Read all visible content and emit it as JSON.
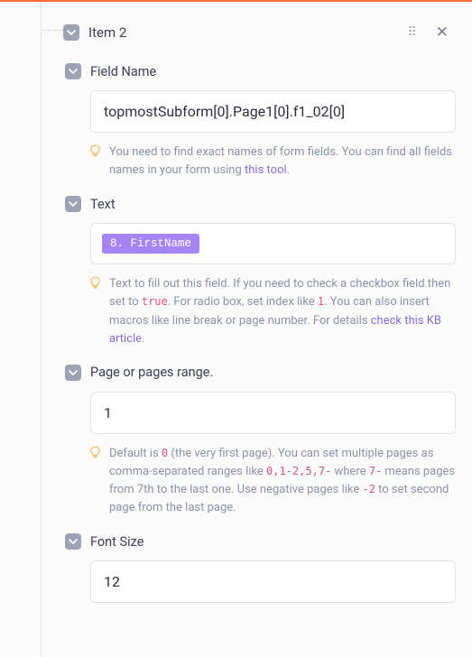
{
  "item": {
    "title": "Item 2",
    "fields": {
      "fieldName": {
        "label": "Field Name",
        "value": "topmostSubform[0].Page1[0].f1_02[0]",
        "hint_pre": "You need to find exact names of form fields. You can find all fields names in your form using ",
        "hint_link": "this tool",
        "hint_post": "."
      },
      "text": {
        "label": "Text",
        "chip": "8. FirstName",
        "hint_p1": "Text to fill out this field. If you need to check a checkbox field then set to ",
        "code_true": "true",
        "hint_p2": ". For radio box, set index like ",
        "code_1": "1",
        "hint_p3": ". You can also insert macros like line break or page number. For details ",
        "hint_link": "check this KB article",
        "hint_p4": "."
      },
      "pages": {
        "label": "Page or pages range.",
        "value": "1",
        "hint_p1": "Default is ",
        "code_0": "0",
        "hint_p2": " (the very first page). You can set multiple pages as comma-separated ranges like ",
        "code_range": "0,1-2,5,7-",
        "hint_p3": " where ",
        "code_7": "7-",
        "hint_p4": " means pages from 7th to the last one. Use negative pages like ",
        "code_neg": "-2",
        "hint_p5": " to set second page from the last page."
      },
      "fontSize": {
        "label": "Font Size",
        "value": "12"
      }
    }
  }
}
